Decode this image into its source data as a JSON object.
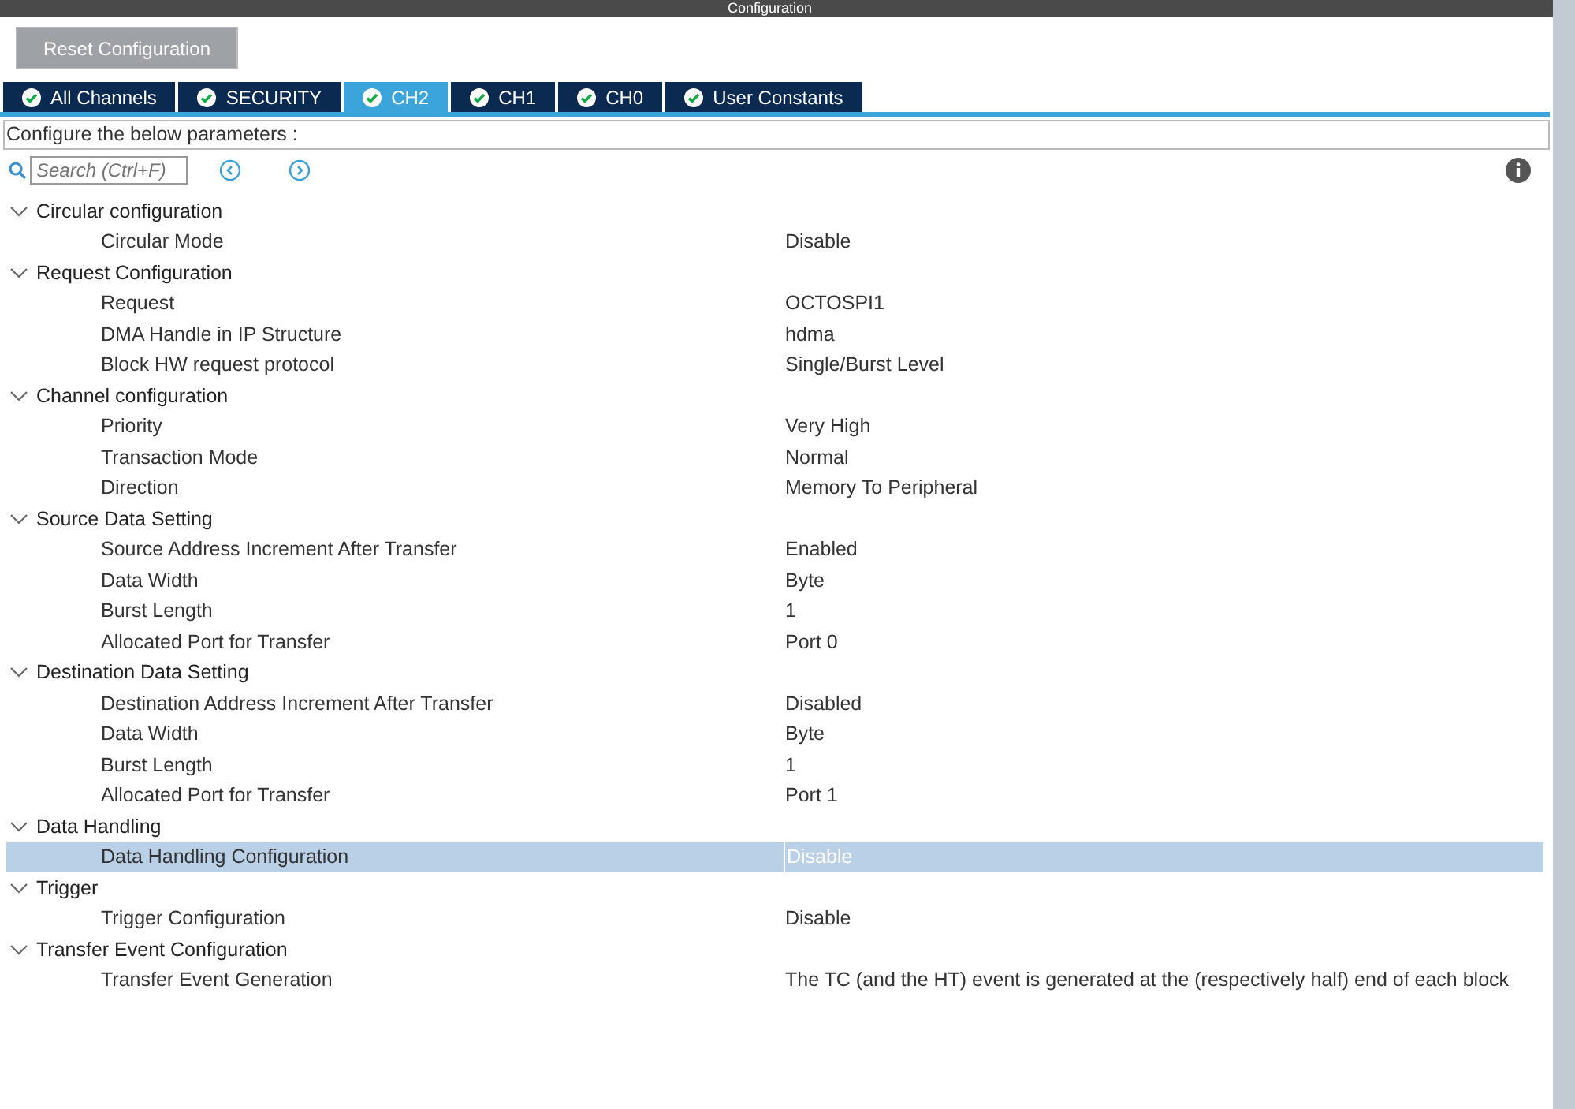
{
  "window": {
    "title": "Configuration"
  },
  "reset_button": "Reset Configuration",
  "tabs": [
    {
      "label": "All Channels",
      "selected": false
    },
    {
      "label": "SECURITY",
      "selected": false
    },
    {
      "label": "CH2",
      "selected": true
    },
    {
      "label": "CH1",
      "selected": false
    },
    {
      "label": "CH0",
      "selected": false
    },
    {
      "label": "User Constants",
      "selected": false
    }
  ],
  "description": "Configure the below parameters :",
  "search": {
    "placeholder": "Search (Ctrl+F)"
  },
  "tree": [
    {
      "label": "Circular configuration",
      "expanded": true,
      "children": [
        {
          "label": "Circular Mode",
          "value": "Disable",
          "selected": false
        }
      ]
    },
    {
      "label": "Request Configuration",
      "expanded": true,
      "children": [
        {
          "label": "Request",
          "value": "OCTOSPI1",
          "selected": false
        },
        {
          "label": "DMA Handle in IP Structure",
          "value": "hdma",
          "selected": false
        },
        {
          "label": "Block HW request protocol",
          "value": "Single/Burst Level",
          "selected": false
        }
      ]
    },
    {
      "label": "Channel configuration",
      "expanded": true,
      "children": [
        {
          "label": "Priority",
          "value": "Very High",
          "selected": false
        },
        {
          "label": "Transaction Mode",
          "value": "Normal",
          "selected": false
        },
        {
          "label": "Direction",
          "value": "Memory To Peripheral",
          "selected": false
        }
      ]
    },
    {
      "label": "Source Data Setting",
      "expanded": true,
      "children": [
        {
          "label": "Source Address Increment After Transfer",
          "value": "Enabled",
          "selected": false
        },
        {
          "label": "Data Width",
          "value": "Byte",
          "selected": false
        },
        {
          "label": "Burst Length",
          "value": "1",
          "selected": false
        },
        {
          "label": "Allocated Port for Transfer",
          "value": "Port 0",
          "selected": false
        }
      ]
    },
    {
      "label": "Destination Data Setting",
      "expanded": true,
      "children": [
        {
          "label": "Destination Address Increment After Transfer",
          "value": "Disabled",
          "selected": false
        },
        {
          "label": "Data Width",
          "value": "Byte",
          "selected": false
        },
        {
          "label": "Burst Length",
          "value": "1",
          "selected": false
        },
        {
          "label": "Allocated Port for Transfer",
          "value": "Port 1",
          "selected": false
        }
      ]
    },
    {
      "label": "Data Handling",
      "expanded": true,
      "children": [
        {
          "label": "Data Handling Configuration",
          "value": "Disable",
          "selected": true
        }
      ]
    },
    {
      "label": "Trigger",
      "expanded": true,
      "children": [
        {
          "label": "Trigger Configuration",
          "value": "Disable",
          "selected": false
        }
      ]
    },
    {
      "label": "Transfer Event Configuration",
      "expanded": true,
      "children": [
        {
          "label": "Transfer Event Generation",
          "value": "The TC (and the HT) event is generated at the (respectively half) end of each block",
          "selected": false
        }
      ]
    }
  ]
}
